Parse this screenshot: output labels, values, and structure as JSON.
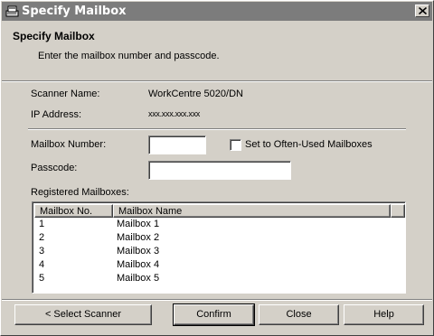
{
  "window": {
    "title": "Specify Mailbox"
  },
  "header": {
    "title": "Specify Mailbox",
    "subtitle": "Enter the mailbox number and passcode."
  },
  "info": {
    "scanner_name_label": "Scanner Name:",
    "scanner_name_value": "WorkCentre 5020/DN",
    "ip_label": "IP Address:",
    "ip_value": "xxx.xxx.xxx.xxx"
  },
  "form": {
    "mailbox_number_label": "Mailbox Number:",
    "mailbox_number_value": "",
    "often_used_label": "Set to Often-Used Mailboxes",
    "often_used_checked": false,
    "passcode_label": "Passcode:",
    "passcode_value": ""
  },
  "registered": {
    "label": "Registered Mailboxes:",
    "columns": [
      "Mailbox No.",
      "Mailbox Name"
    ],
    "rows": [
      {
        "no": "1",
        "name": "Mailbox 1"
      },
      {
        "no": "2",
        "name": "Mailbox 2"
      },
      {
        "no": "3",
        "name": "Mailbox 3"
      },
      {
        "no": "4",
        "name": "Mailbox 4"
      },
      {
        "no": "5",
        "name": "Mailbox 5"
      }
    ]
  },
  "buttons": {
    "select_scanner": "< Select Scanner",
    "confirm": "Confirm",
    "close": "Close",
    "help": "Help"
  },
  "icons": {
    "app": "scanner-app-icon",
    "close": "close-icon"
  }
}
